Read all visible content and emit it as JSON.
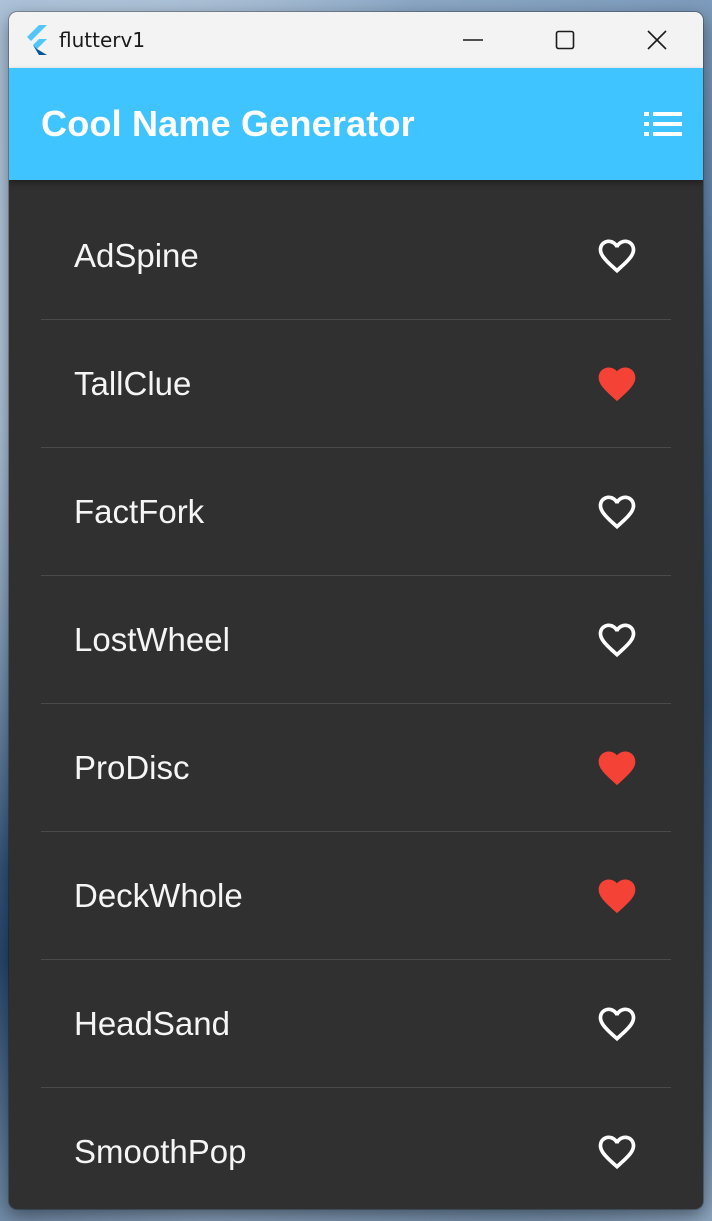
{
  "window": {
    "title": "flutterv1",
    "controls": [
      "minimize",
      "maximize",
      "close"
    ]
  },
  "appbar": {
    "title": "Cool Name Generator",
    "action_icon": "list-icon",
    "color": "#40c4ff"
  },
  "colors": {
    "background": "#303030",
    "favorite": "#f44336",
    "not_favorite": "#ffffff"
  },
  "items": [
    {
      "name": "AdSpine",
      "favorite": false
    },
    {
      "name": "TallClue",
      "favorite": true
    },
    {
      "name": "FactFork",
      "favorite": false
    },
    {
      "name": "LostWheel",
      "favorite": false
    },
    {
      "name": "ProDisc",
      "favorite": true
    },
    {
      "name": "DeckWhole",
      "favorite": true
    },
    {
      "name": "HeadSand",
      "favorite": false
    },
    {
      "name": "SmoothPop",
      "favorite": false
    }
  ]
}
